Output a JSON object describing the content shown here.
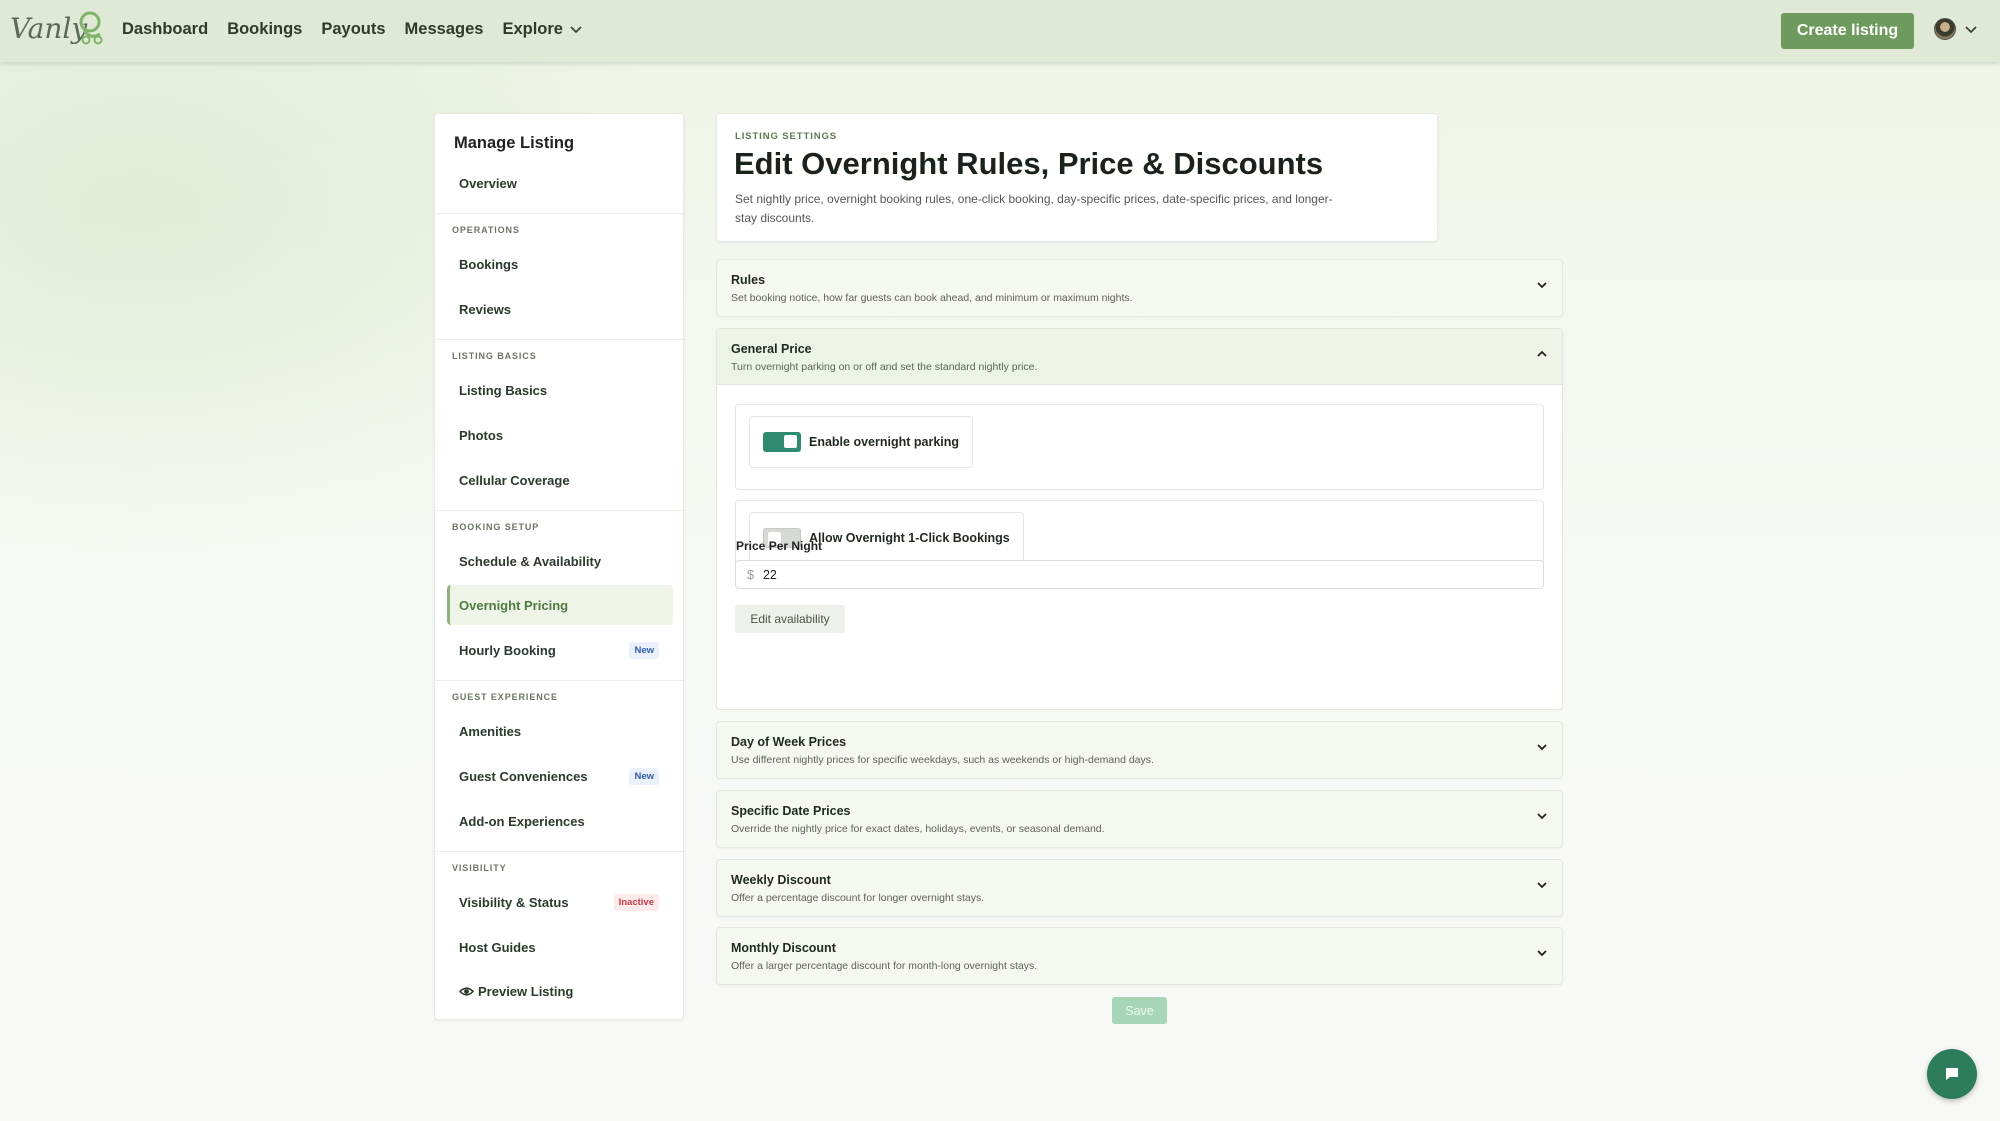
{
  "nav": {
    "logo_text": "Vanly",
    "links": [
      {
        "label": "Dashboard"
      },
      {
        "label": "Bookings"
      },
      {
        "label": "Payouts"
      },
      {
        "label": "Messages"
      },
      {
        "label": "Explore"
      }
    ],
    "create_label": "Create listing"
  },
  "sidebar": {
    "title": "Manage Listing",
    "overview": "Overview",
    "sections": {
      "operations": "OPERATIONS",
      "listing_basics": "LISTING BASICS",
      "booking_setup": "BOOKING SETUP",
      "guest_experience": "GUEST EXPERIENCE",
      "visibility": "VISIBILITY"
    },
    "items": {
      "bookings": "Bookings",
      "reviews": "Reviews",
      "listing_basics": "Listing Basics",
      "photos": "Photos",
      "cellular": "Cellular Coverage",
      "schedule": "Schedule & Availability",
      "overnight_pricing": "Overnight Pricing",
      "hourly_booking": "Hourly Booking",
      "amenities": "Amenities",
      "guest_conveniences": "Guest Conveniences",
      "addon": "Add-on Experiences",
      "visibility_status": "Visibility & Status",
      "host_guides": "Host Guides",
      "preview": "Preview Listing"
    },
    "badges": {
      "hourly_booking": "New",
      "guest_conveniences": "New",
      "visibility_status": "Inactive"
    }
  },
  "header": {
    "eyebrow": "LISTING SETTINGS",
    "title": "Edit Overnight Rules, Price & Discounts",
    "description": "Set nightly price, overnight booking rules, one-click booking, day-specific prices, date-specific prices, and longer-stay discounts."
  },
  "sections": {
    "rules": {
      "title": "Rules",
      "subtitle": "Set booking notice, how far guests can book ahead, and minimum or maximum nights."
    },
    "general_price": {
      "title": "General Price",
      "subtitle": "Turn overnight parking on or off and set the standard nightly price.",
      "toggle_overnight": {
        "label": "Enable overnight parking",
        "on": true
      },
      "toggle_oneclick": {
        "label": "Allow Overnight 1-Click Bookings",
        "on": false
      },
      "price_label": "Price Per Night",
      "currency": "$",
      "price_value": "22",
      "edit_availability": "Edit availability"
    },
    "day_of_week": {
      "title": "Day of Week Prices",
      "subtitle": "Use different nightly prices for specific weekdays, such as weekends or high-demand days."
    },
    "specific_date": {
      "title": "Specific Date Prices",
      "subtitle": "Override the nightly price for exact dates, holidays, events, or seasonal demand."
    },
    "weekly": {
      "title": "Weekly Discount",
      "subtitle": "Offer a percentage discount for longer overnight stays."
    },
    "monthly": {
      "title": "Monthly Discount",
      "subtitle": "Offer a larger percentage discount for month-long overnight stays."
    }
  },
  "save_label": "Save",
  "colors": {
    "brand": "#6e9a5e",
    "toggle_on": "#2f8a6f",
    "chat": "#2d7d5a"
  }
}
